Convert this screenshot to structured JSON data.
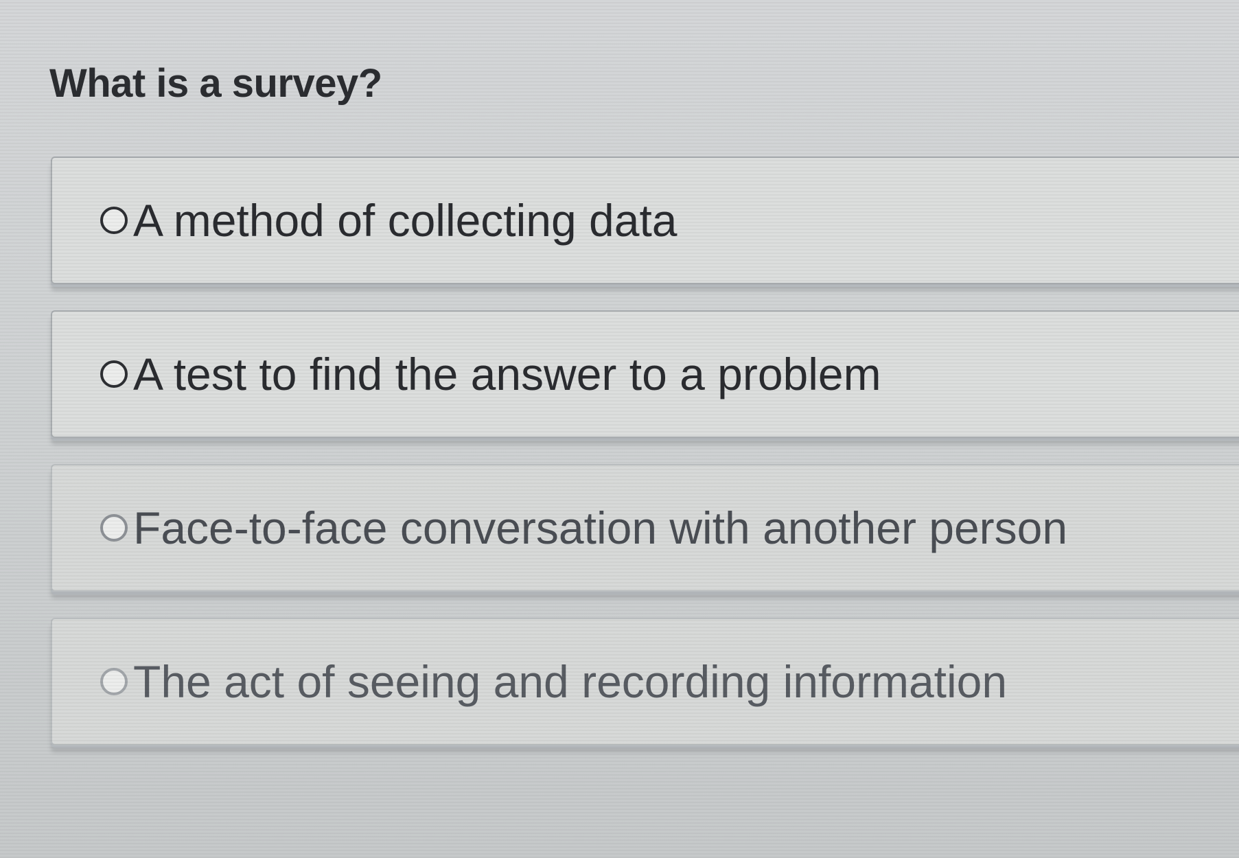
{
  "question": {
    "text": "What is a survey?"
  },
  "options": [
    {
      "label": "A method of collecting data",
      "selected": false
    },
    {
      "label": "A test to find the answer to a problem",
      "selected": false
    },
    {
      "label": "Face-to-face conversation with another person",
      "selected": false
    },
    {
      "label": "The act of seeing and recording information",
      "selected": false
    }
  ],
  "colors": {
    "text": "#2a2c30",
    "background": "#d4d6d8",
    "option_background": "#dcdedd",
    "option_border": "#a9adb0"
  }
}
